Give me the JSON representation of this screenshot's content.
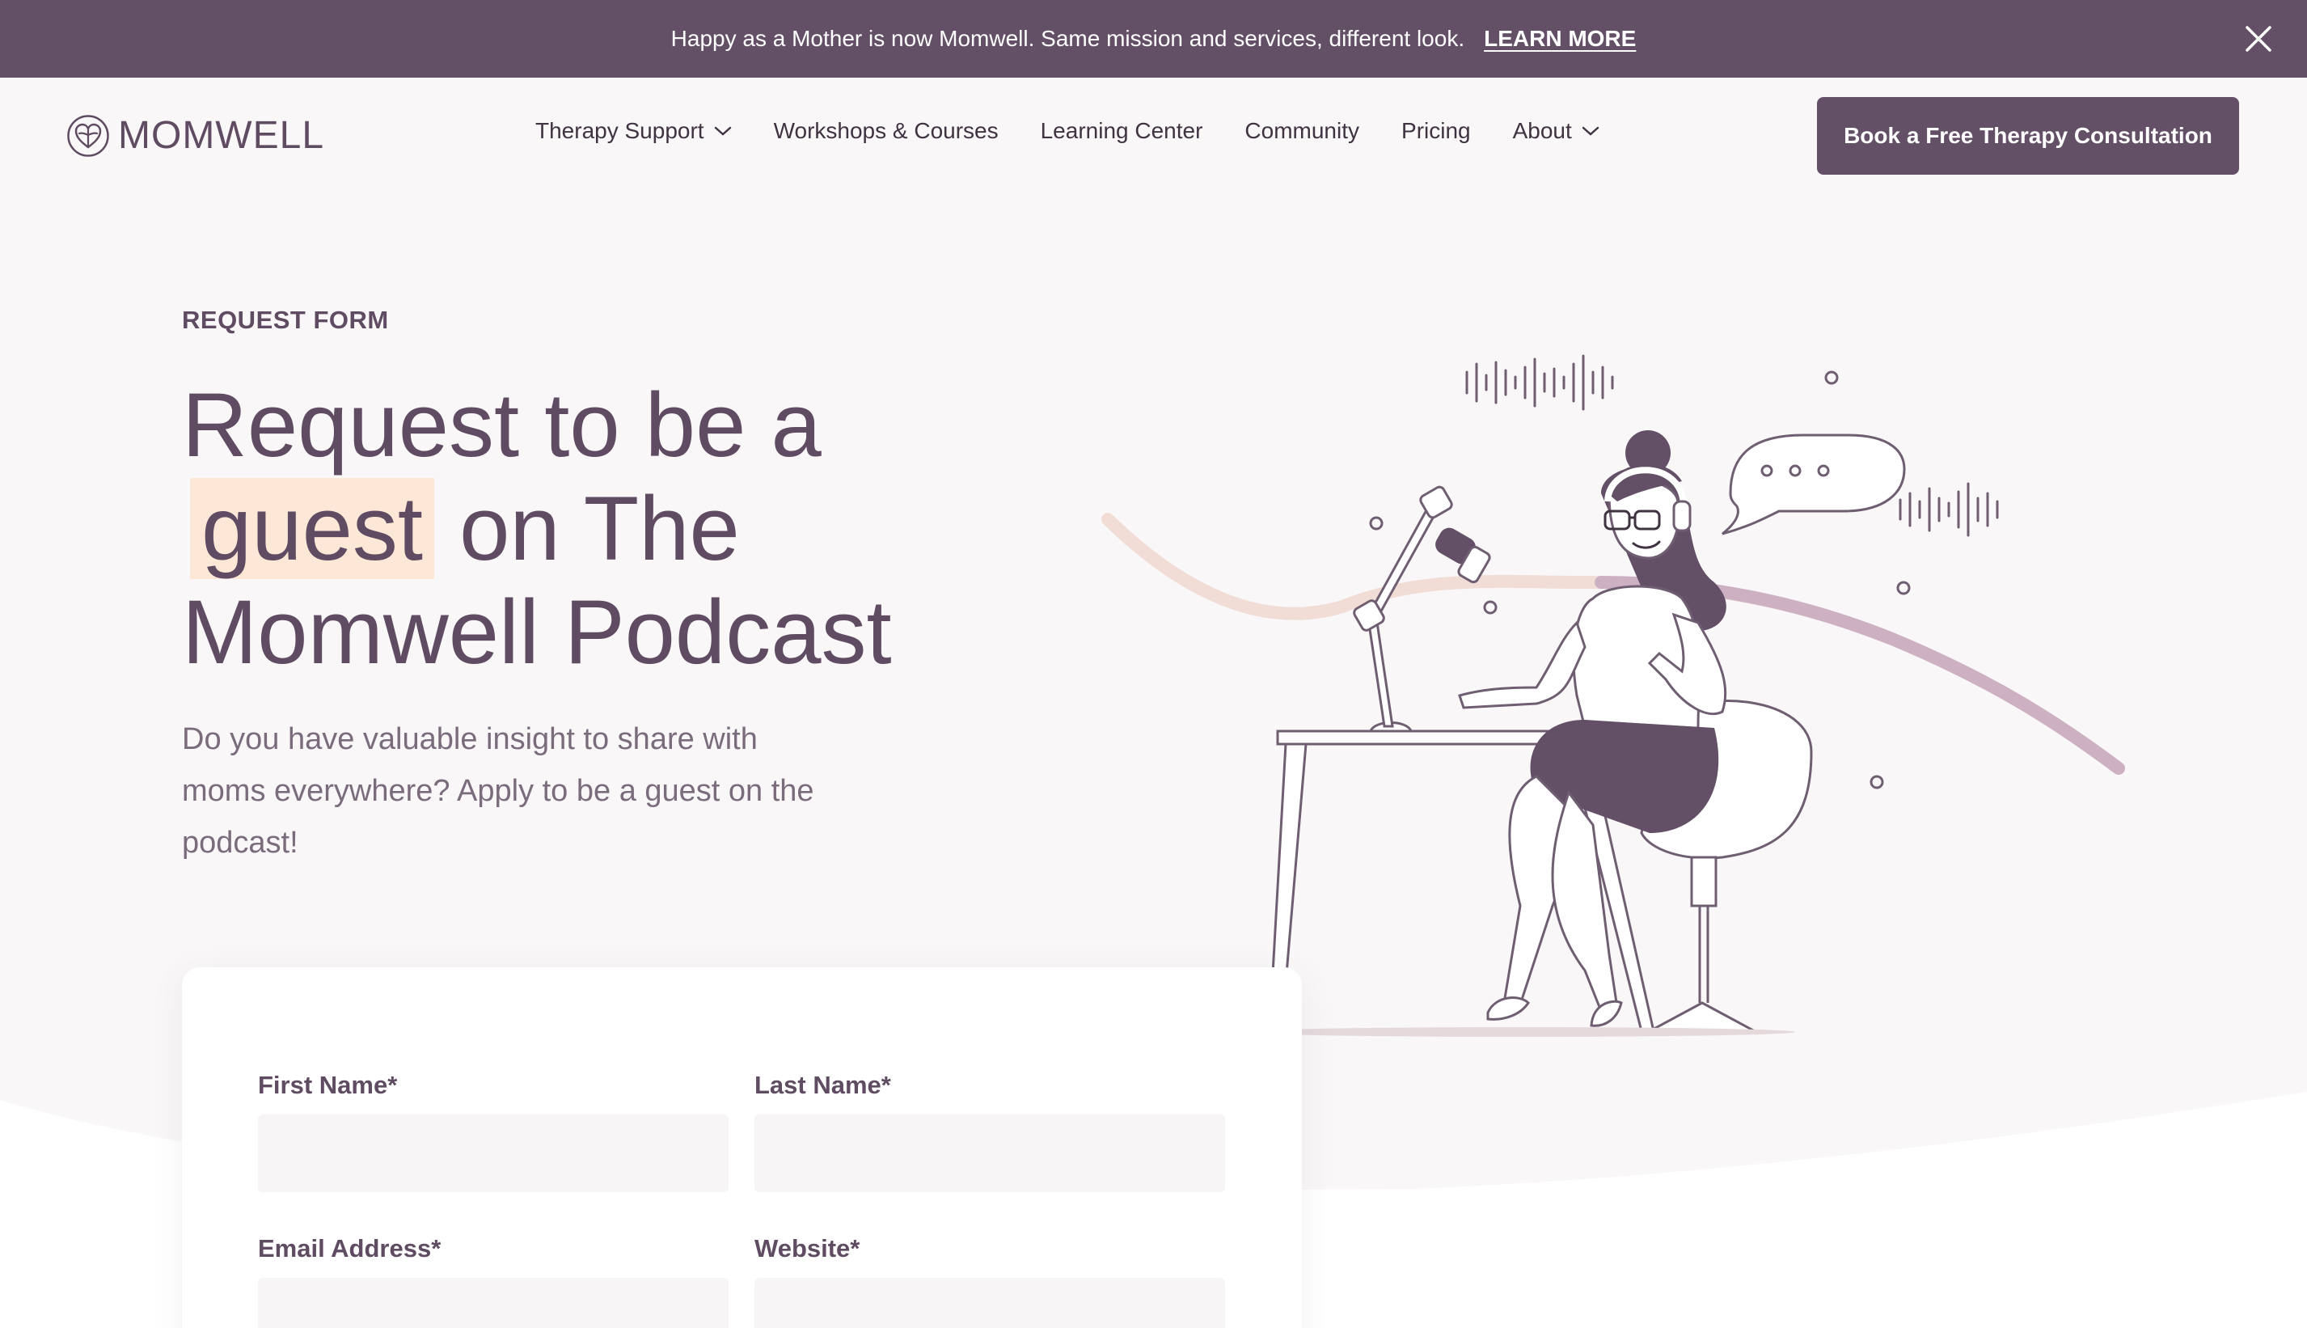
{
  "announcement": {
    "message": "Happy as a Mother is now Momwell. Same mission and services, different look.",
    "link_label": "LEARN MORE",
    "close_icon": "close-icon"
  },
  "brand": {
    "name": "MOMWELL",
    "logo_icon": "heart-leaf-icon"
  },
  "nav": {
    "items": [
      {
        "label": "Therapy Support",
        "has_dropdown": true
      },
      {
        "label": "Workshops & Courses",
        "has_dropdown": false
      },
      {
        "label": "Learning Center",
        "has_dropdown": false
      },
      {
        "label": "Community",
        "has_dropdown": false
      },
      {
        "label": "Pricing",
        "has_dropdown": false
      },
      {
        "label": "About",
        "has_dropdown": true
      }
    ],
    "cta_label": "Book a Free Therapy Consultation"
  },
  "hero": {
    "eyebrow": "REQUEST FORM",
    "title_line1": "Request to be a",
    "title_highlight": "guest",
    "title_line2_rest": " on The",
    "title_line3": "Momwell Podcast",
    "subtitle": "Do you have valuable insight to share with moms everywhere? Apply to be a guest on the podcast!",
    "illustration": "podcast-host-illustration"
  },
  "form": {
    "first_name_label": "First Name*",
    "last_name_label": "Last Name*",
    "email_label": "Email Address*",
    "website_label": "Website*",
    "first_name_value": "",
    "last_name_value": "",
    "email_value": "",
    "website_value": ""
  },
  "colors": {
    "brand_plum": "#634f66",
    "text_plum": "#5f4b62",
    "highlight_peach": "#fde7d7",
    "page_bg": "#f9f7f8"
  }
}
